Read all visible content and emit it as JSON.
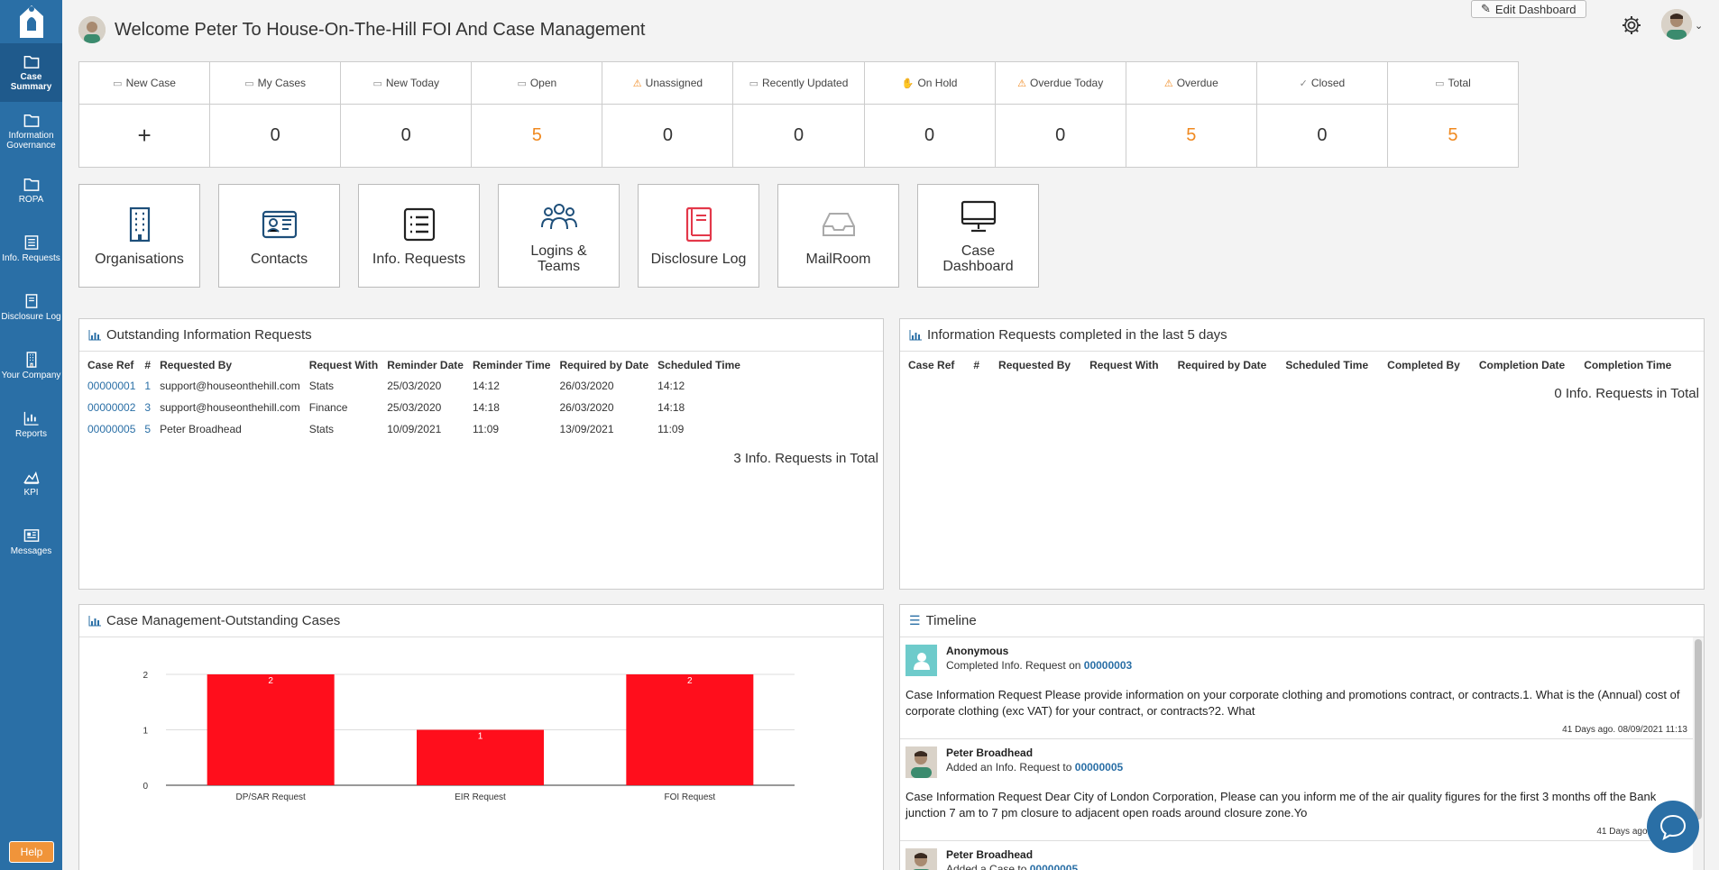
{
  "sidebar": {
    "items": [
      {
        "label": "Case Summary",
        "icon": "folder-icon"
      },
      {
        "label": "Information Governance",
        "icon": "folder-icon"
      },
      {
        "label": "ROPA",
        "icon": "folder-icon"
      },
      {
        "label": "Info. Requests",
        "icon": "list-icon"
      },
      {
        "label": "Disclosure Log",
        "icon": "book-icon"
      },
      {
        "label": "Your Company",
        "icon": "building-icon"
      },
      {
        "label": "Reports",
        "icon": "bar-chart-icon"
      },
      {
        "label": "KPI",
        "icon": "area-chart-icon"
      },
      {
        "label": "Messages",
        "icon": "newspaper-icon"
      }
    ],
    "help_label": "Help"
  },
  "header": {
    "title": "Welcome Peter To House-On-The-Hill FOI And Case Management",
    "edit_dashboard": "Edit Dashboard"
  },
  "stats": [
    {
      "label": "New Case",
      "value": "+",
      "icon": "card-icon",
      "highlight": false
    },
    {
      "label": "My Cases",
      "value": "0",
      "icon": "card-icon",
      "highlight": false
    },
    {
      "label": "New Today",
      "value": "0",
      "icon": "card-icon",
      "highlight": false
    },
    {
      "label": "Open",
      "value": "5",
      "icon": "card-icon",
      "highlight": true
    },
    {
      "label": "Unassigned",
      "value": "0",
      "icon": "warning-icon",
      "highlight": false
    },
    {
      "label": "Recently Updated",
      "value": "0",
      "icon": "card-icon",
      "highlight": false
    },
    {
      "label": "On Hold",
      "value": "0",
      "icon": "hand-icon",
      "highlight": false
    },
    {
      "label": "Overdue Today",
      "value": "0",
      "icon": "warning-icon",
      "highlight": false
    },
    {
      "label": "Overdue",
      "value": "5",
      "icon": "warning-icon",
      "highlight": true
    },
    {
      "label": "Closed",
      "value": "0",
      "icon": "check-circle-icon",
      "highlight": false
    },
    {
      "label": "Total",
      "value": "5",
      "icon": "inbox-icon",
      "highlight": true
    }
  ],
  "tiles": [
    {
      "label": "Organisations",
      "icon": "building-icon"
    },
    {
      "label": "Contacts",
      "icon": "id-card-icon"
    },
    {
      "label": "Info. Requests",
      "icon": "list-icon"
    },
    {
      "label": "Logins & Teams",
      "icon": "users-icon"
    },
    {
      "label": "Disclosure Log",
      "icon": "book-icon"
    },
    {
      "label": "MailRoom",
      "icon": "inbox-icon"
    },
    {
      "label": "Case Dashboard",
      "icon": "monitor-icon"
    }
  ],
  "outstanding": {
    "title": "Outstanding Information Requests",
    "columns": [
      "Case Ref",
      "#",
      "Requested By",
      "Request With",
      "Reminder Date",
      "Reminder Time",
      "Required by Date",
      "Scheduled Time"
    ],
    "rows": [
      [
        "00000001",
        "1",
        "support@houseonthehill.com",
        "Stats",
        "25/03/2020",
        "14:12",
        "26/03/2020",
        "14:12"
      ],
      [
        "00000002",
        "3",
        "support@houseonthehill.com",
        "Finance",
        "25/03/2020",
        "14:18",
        "26/03/2020",
        "14:18"
      ],
      [
        "00000005",
        "5",
        "Peter Broadhead",
        "Stats",
        "10/09/2021",
        "11:09",
        "13/09/2021",
        "11:09"
      ]
    ],
    "total": "3 Info. Requests in Total"
  },
  "completed": {
    "title": "Information Requests completed in the last 5 days",
    "columns": [
      "Case Ref",
      "#",
      "Requested By",
      "Request With",
      "Required by Date",
      "Scheduled Time",
      "Completed By",
      "Completion Date",
      "Completion Time"
    ],
    "total": "0 Info. Requests in Total"
  },
  "case_chart": {
    "title": "Case Management-Outstanding Cases"
  },
  "chart_data": {
    "type": "bar",
    "categories": [
      "DP/SAR Request",
      "EIR Request",
      "FOI Request"
    ],
    "values": [
      2,
      1,
      2
    ],
    "ylim": [
      0,
      2
    ],
    "yticks": [
      "0",
      "1",
      "2"
    ],
    "color": "#ff0e1c",
    "grid": true
  },
  "timeline": {
    "title": "Timeline",
    "items": [
      {
        "name": "Anonymous",
        "action": "Completed Info. Request on",
        "ref": "00000003",
        "body": "Case Information Request Please provide information on your corporate clothing and promotions contract, or contracts.1. What is the (Annual) cost of corporate clothing (exc VAT) for your contract, or contracts?2. What",
        "time": "41 Days ago. 08/09/2021 11:13"
      },
      {
        "name": "Peter Broadhead",
        "action": "Added an Info. Request to",
        "ref": "00000005",
        "body": "Case Information Request Dear City of London Corporation, Please can you inform me of the air quality figures for the first 3 months off the Bank junction 7 am to 7 pm closure to adjacent open roads around closure zone.Yo",
        "time": "41 Days ago. 08/09/20"
      },
      {
        "name": "Peter Broadhead",
        "action": "Added a Case to",
        "ref": "00000005",
        "body": "",
        "time": ""
      }
    ]
  }
}
